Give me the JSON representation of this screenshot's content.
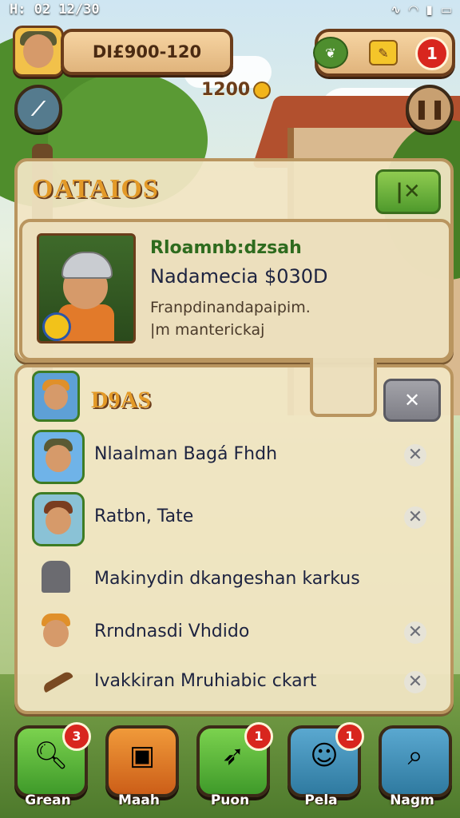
{
  "status_bar": {
    "time": "H: 02  12/30",
    "icons": [
      "nfc-icon",
      "wifi-icon",
      "signal-icon",
      "battery-icon"
    ]
  },
  "hud": {
    "player_name": "DI£900-120",
    "coins": "1200",
    "resource_alert_count": "1"
  },
  "main_panel": {
    "title": "OATAIOS",
    "close_label": "X",
    "card": {
      "line1": "Rloamnb:dzsah",
      "line2": "Nadamecia  $030D",
      "line3": "Franpdinandapaipim.",
      "line4": "|m manterickaj"
    }
  },
  "list_panel": {
    "title": "D9AS",
    "close_label": "✕",
    "items": [
      {
        "label": "Nlaalman Bagá Fhdh",
        "icon": "soldier-helmet-icon",
        "closable": true
      },
      {
        "label": "Ratbn, Tate",
        "icon": "bandana-warrior-icon",
        "closable": true
      },
      {
        "label": "Makinydin dkangeshan karkus",
        "icon": "knight-helmet-icon",
        "closable": false
      },
      {
        "label": "Rrndnasdi Vhdido",
        "icon": "villager-icon",
        "closable": true
      },
      {
        "label": "Ivakkiran Mruhiabic ckart",
        "icon": "pickaxe-icon",
        "closable": true
      }
    ]
  },
  "nav": [
    {
      "label": "Grean",
      "icon": "magnifier-icon",
      "badge": "3",
      "color": "#5fb33a"
    },
    {
      "label": "Maah",
      "icon": "treasure-icon",
      "badge": "",
      "color": "#e07a24"
    },
    {
      "label": "Puon",
      "icon": "rocket-icon",
      "badge": "1",
      "color": "#5fb33a"
    },
    {
      "label": "Pela",
      "icon": "monster-icon",
      "badge": "1",
      "color": "#3f8fb8"
    },
    {
      "label": "Nagm",
      "icon": "search-map-icon",
      "badge": "",
      "color": "#3f8fb8"
    }
  ]
}
